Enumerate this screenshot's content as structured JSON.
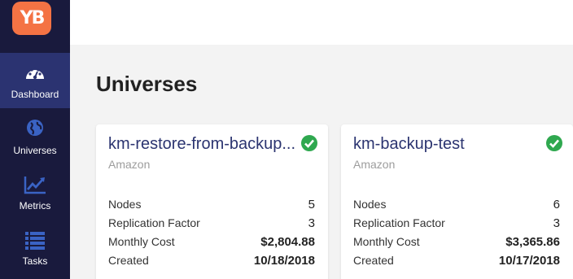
{
  "app": {
    "logo_text": "YB"
  },
  "sidebar": {
    "items": [
      {
        "label": "Dashboard",
        "icon": "dashboard-gauge-icon",
        "active": true
      },
      {
        "label": "Universes",
        "icon": "globe-icon",
        "active": false
      },
      {
        "label": "Metrics",
        "icon": "line-chart-icon",
        "active": false
      },
      {
        "label": "Tasks",
        "icon": "task-list-icon",
        "active": false
      }
    ]
  },
  "main": {
    "title": "Universes"
  },
  "colors": {
    "sidebar_bg": "#191a3d",
    "sidebar_active": "#2b3371",
    "brand_orange": "#f47344",
    "status_green": "#2fa84f",
    "link_navy": "#2b3470"
  },
  "universes": [
    {
      "name": "km-restore-from-backup...",
      "provider": "Amazon",
      "status_icon": "check-circle-icon",
      "stats": [
        {
          "label": "Nodes",
          "value": "5"
        },
        {
          "label": "Replication Factor",
          "value": "3"
        },
        {
          "label": "Monthly Cost",
          "value": "$2,804.88"
        },
        {
          "label": "Created",
          "value": "10/18/2018"
        }
      ]
    },
    {
      "name": "km-backup-test",
      "provider": "Amazon",
      "status_icon": "check-circle-icon",
      "stats": [
        {
          "label": "Nodes",
          "value": "6"
        },
        {
          "label": "Replication Factor",
          "value": "3"
        },
        {
          "label": "Monthly Cost",
          "value": "$3,365.86"
        },
        {
          "label": "Created",
          "value": "10/17/2018"
        }
      ]
    }
  ]
}
